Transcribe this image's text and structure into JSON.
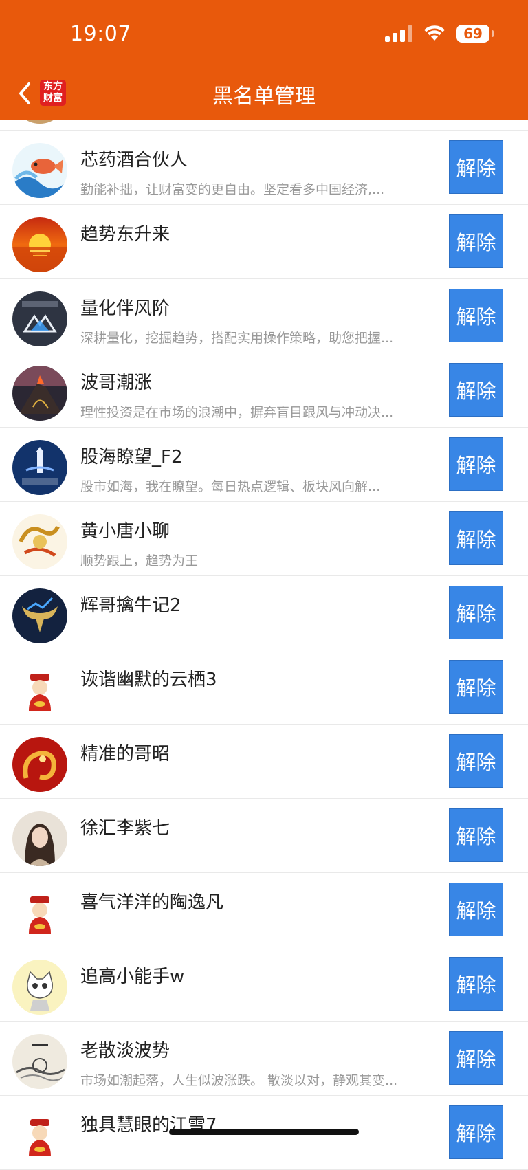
{
  "status": {
    "time": "19:07",
    "battery": "69"
  },
  "header": {
    "title": "黑名单管理",
    "app_logo_line1": "东方",
    "app_logo_line2": "财富"
  },
  "colors": {
    "header_bg": "#E8590C",
    "button_bg": "#3886E6"
  },
  "button_label": "解除",
  "rows": [
    {
      "name": "",
      "desc": ""
    },
    {
      "name": "芯药酒合伙人",
      "desc": "勤能补拙，让财富变的更自由。坚定看多中国经济,...",
      "avatar": "koi-fish-avatar"
    },
    {
      "name": "趋势东升来",
      "desc": "",
      "avatar": "sunset-avatar"
    },
    {
      "name": "量化伴风阶",
      "desc": "深耕量化，挖掘趋势，搭配实用操作策略，助您把握...",
      "avatar": "quant-logo-avatar"
    },
    {
      "name": "波哥潮涨",
      "desc": "理性投资是在市场的浪潮中，摒弃盲目跟风与冲动决...",
      "avatar": "volcano-avatar"
    },
    {
      "name": "股海瞭望_F2",
      "desc": "股市如海，我在瞭望。每日热点逻辑、板块风向解...",
      "avatar": "lighthouse-avatar"
    },
    {
      "name": "黄小唐小聊",
      "desc": "顺势跟上，趋势为王",
      "avatar": "dragon-avatar"
    },
    {
      "name": "辉哥擒牛记2",
      "desc": "",
      "avatar": "bull-avatar"
    },
    {
      "name": "诙谐幽默的云栖3",
      "desc": "",
      "avatar": "fortune-god-avatar"
    },
    {
      "name": "精准的哥昭",
      "desc": "",
      "avatar": "red-dragon-avatar"
    },
    {
      "name": "徐汇李紫七",
      "desc": "",
      "avatar": "portrait-avatar"
    },
    {
      "name": "喜气洋洋的陶逸凡",
      "desc": "",
      "avatar": "fortune-god-avatar"
    },
    {
      "name": "追高小能手w",
      "desc": "",
      "avatar": "cat-avatar"
    },
    {
      "name": "老散淡波势",
      "desc": "市场如潮起落，人生似波涨跌。 散淡以对，静观其变...",
      "avatar": "ink-painting-avatar"
    },
    {
      "name": "独具慧眼的江雪7",
      "desc": "",
      "avatar": "fortune-god-avatar"
    }
  ]
}
